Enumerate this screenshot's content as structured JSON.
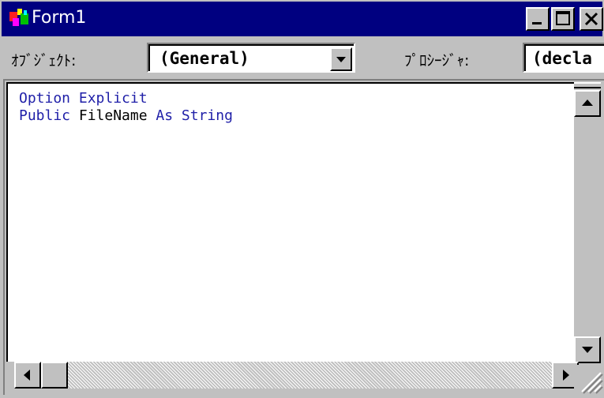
{
  "window": {
    "title": "Form1",
    "controls": {
      "minimize_icon": "minimize-icon",
      "maximize_icon": "maximize-icon",
      "close_icon": "close-icon"
    }
  },
  "selectors": {
    "object_label": "ｵﾌﾞｼﾞｪｸﾄ:",
    "object_value": "(General)",
    "procedure_label": "ﾌﾟﾛｼｰｼﾞｬ:",
    "procedure_value": "(decla"
  },
  "code": {
    "lines": [
      {
        "keyword1": "Option Explicit",
        "text": "",
        "keyword2": "",
        "text2": ""
      },
      {
        "keyword1": "Public",
        "text": " FileName ",
        "keyword2": "As String",
        "text2": ""
      }
    ]
  },
  "colors": {
    "titlebar": "#000080",
    "keyword": "#1f1fa8",
    "face": "#c0c0c0"
  }
}
